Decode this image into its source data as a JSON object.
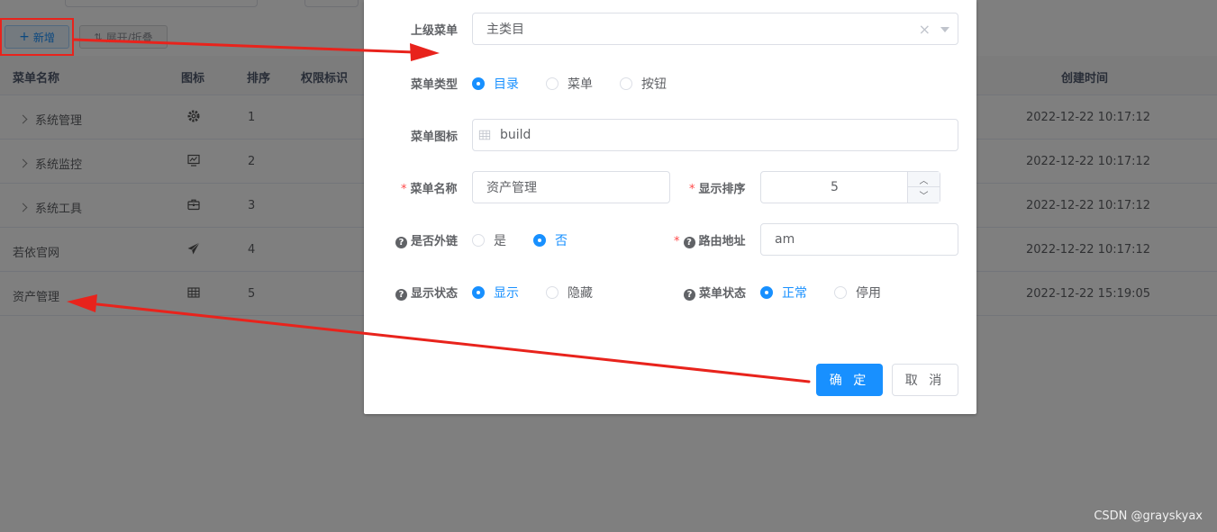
{
  "toolbar": {
    "add_label": "新增",
    "add_icon": "plus-icon",
    "expand_label": "展开/折叠",
    "expand_icon": "sort-icon"
  },
  "table": {
    "headers": {
      "name": "菜单名称",
      "icon": "图标",
      "order": "排序",
      "perm": "权限标识",
      "created": "创建时间"
    },
    "rows": [
      {
        "name": "系统管理",
        "expandable": true,
        "icon": "gear-icon",
        "order": "1",
        "created": "2022-12-22 10:17:12"
      },
      {
        "name": "系统监控",
        "expandable": true,
        "icon": "monitor-icon",
        "order": "2",
        "created": "2022-12-22 10:17:12"
      },
      {
        "name": "系统工具",
        "expandable": true,
        "icon": "toolbox-icon",
        "order": "3",
        "created": "2022-12-22 10:17:12"
      },
      {
        "name": "若依官网",
        "expandable": false,
        "icon": "paper-plane-icon",
        "order": "4",
        "created": "2022-12-22 10:17:12"
      },
      {
        "name": "资产管理",
        "expandable": false,
        "icon": "build-icon",
        "order": "5",
        "created": "2022-12-22 15:19:05"
      }
    ]
  },
  "dialog": {
    "parent": {
      "label": "上级菜单",
      "value": "主类目"
    },
    "type": {
      "label": "菜单类型",
      "options": [
        "目录",
        "菜单",
        "按钮"
      ],
      "selected": "目录"
    },
    "icon_field": {
      "label": "菜单图标",
      "value": "build"
    },
    "name": {
      "label": "菜单名称",
      "value": "资产管理"
    },
    "sort": {
      "label": "显示排序",
      "value": "5"
    },
    "external": {
      "label": "是否外链",
      "options": [
        "是",
        "否"
      ],
      "selected": "否"
    },
    "route": {
      "label": "路由地址",
      "value": "am"
    },
    "visible": {
      "label": "显示状态",
      "options": [
        "显示",
        "隐藏"
      ],
      "selected": "显示"
    },
    "status": {
      "label": "菜单状态",
      "options": [
        "正常",
        "停用"
      ],
      "selected": "正常"
    },
    "confirm": "确 定",
    "cancel": "取 消"
  },
  "colors": {
    "primary": "#1890ff",
    "annotation": "#e8231c",
    "required": "#ff4949"
  },
  "watermark": "CSDN @grayskyax"
}
